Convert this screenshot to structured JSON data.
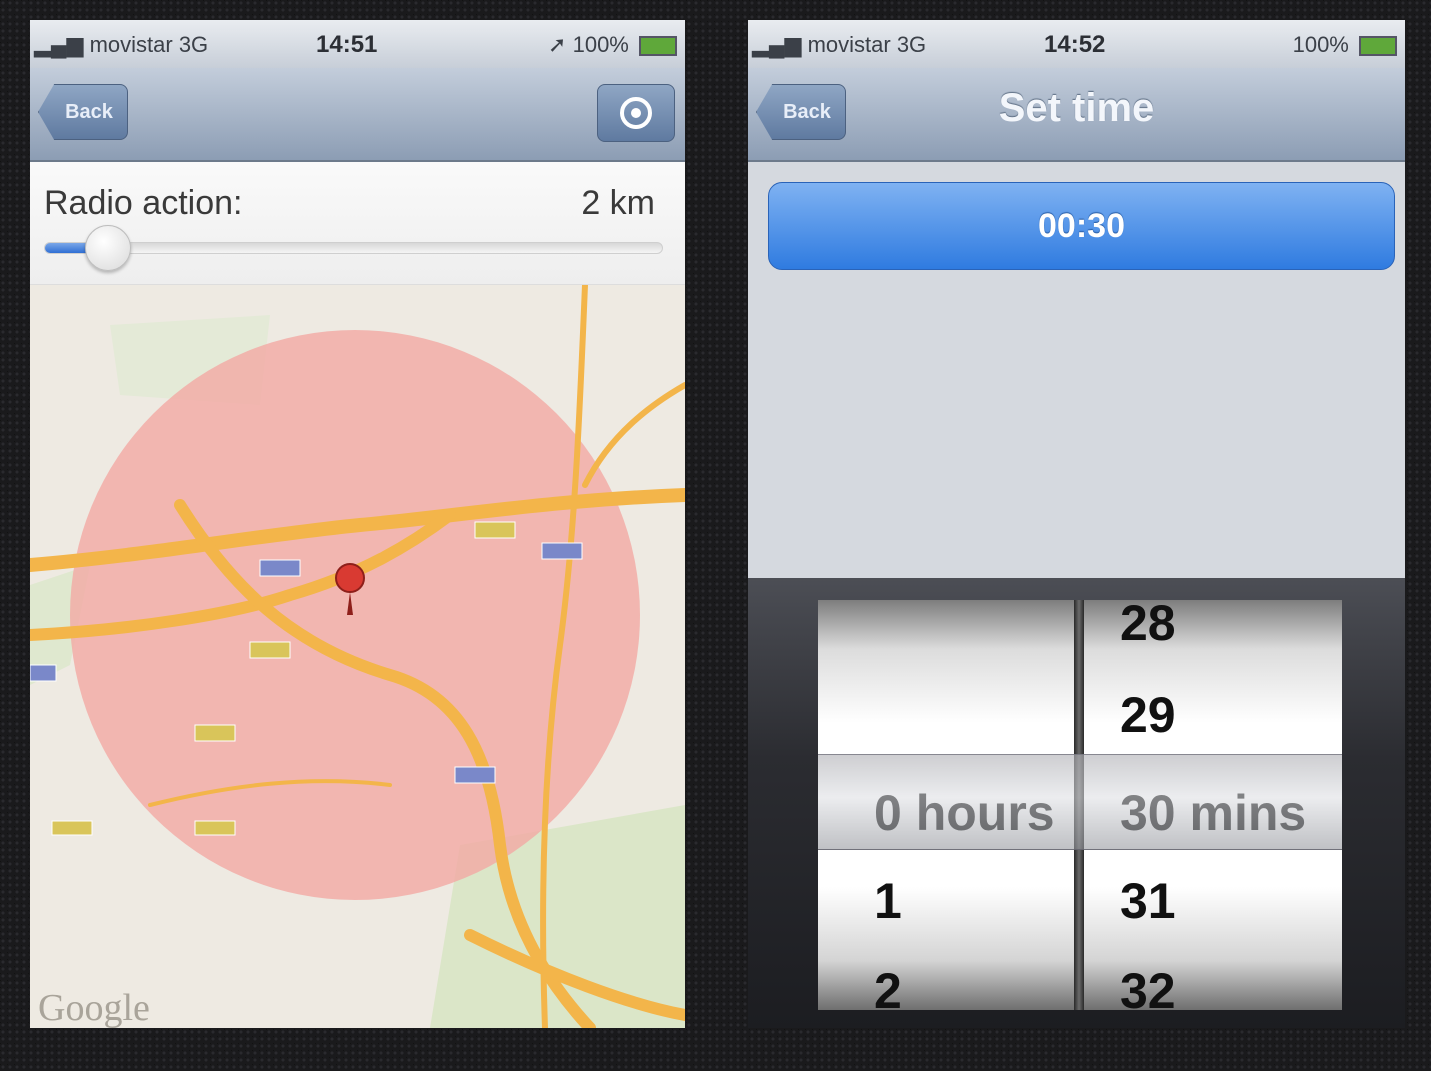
{
  "left_screen": {
    "status": {
      "carrier": "movistar",
      "network": "3G",
      "time": "14:51",
      "battery": "100%"
    },
    "nav": {
      "back_label": "Back"
    },
    "radius": {
      "label": "Radio action:",
      "value": "2 km",
      "slider_fraction": 0.1
    },
    "map": {
      "attribution": "Google"
    },
    "colors": {
      "radius_circle": "#f2a9a4",
      "roads": "#f3b54a",
      "map_bg": "#eeeae2"
    }
  },
  "right_screen": {
    "status": {
      "carrier": "movistar",
      "network": "3G",
      "time": "14:52",
      "battery": "100%"
    },
    "nav": {
      "back_label": "Back",
      "title": "Set time"
    },
    "time_button": {
      "label": "00:30"
    },
    "picker": {
      "hours": {
        "items": [
          "0 hours",
          "1",
          "2"
        ],
        "selected": "0 hours"
      },
      "minutes": {
        "items": [
          "28",
          "29",
          "30 mins",
          "31",
          "32"
        ],
        "selected": "30 mins"
      }
    },
    "colors": {
      "accent": "#2f7be0"
    }
  }
}
